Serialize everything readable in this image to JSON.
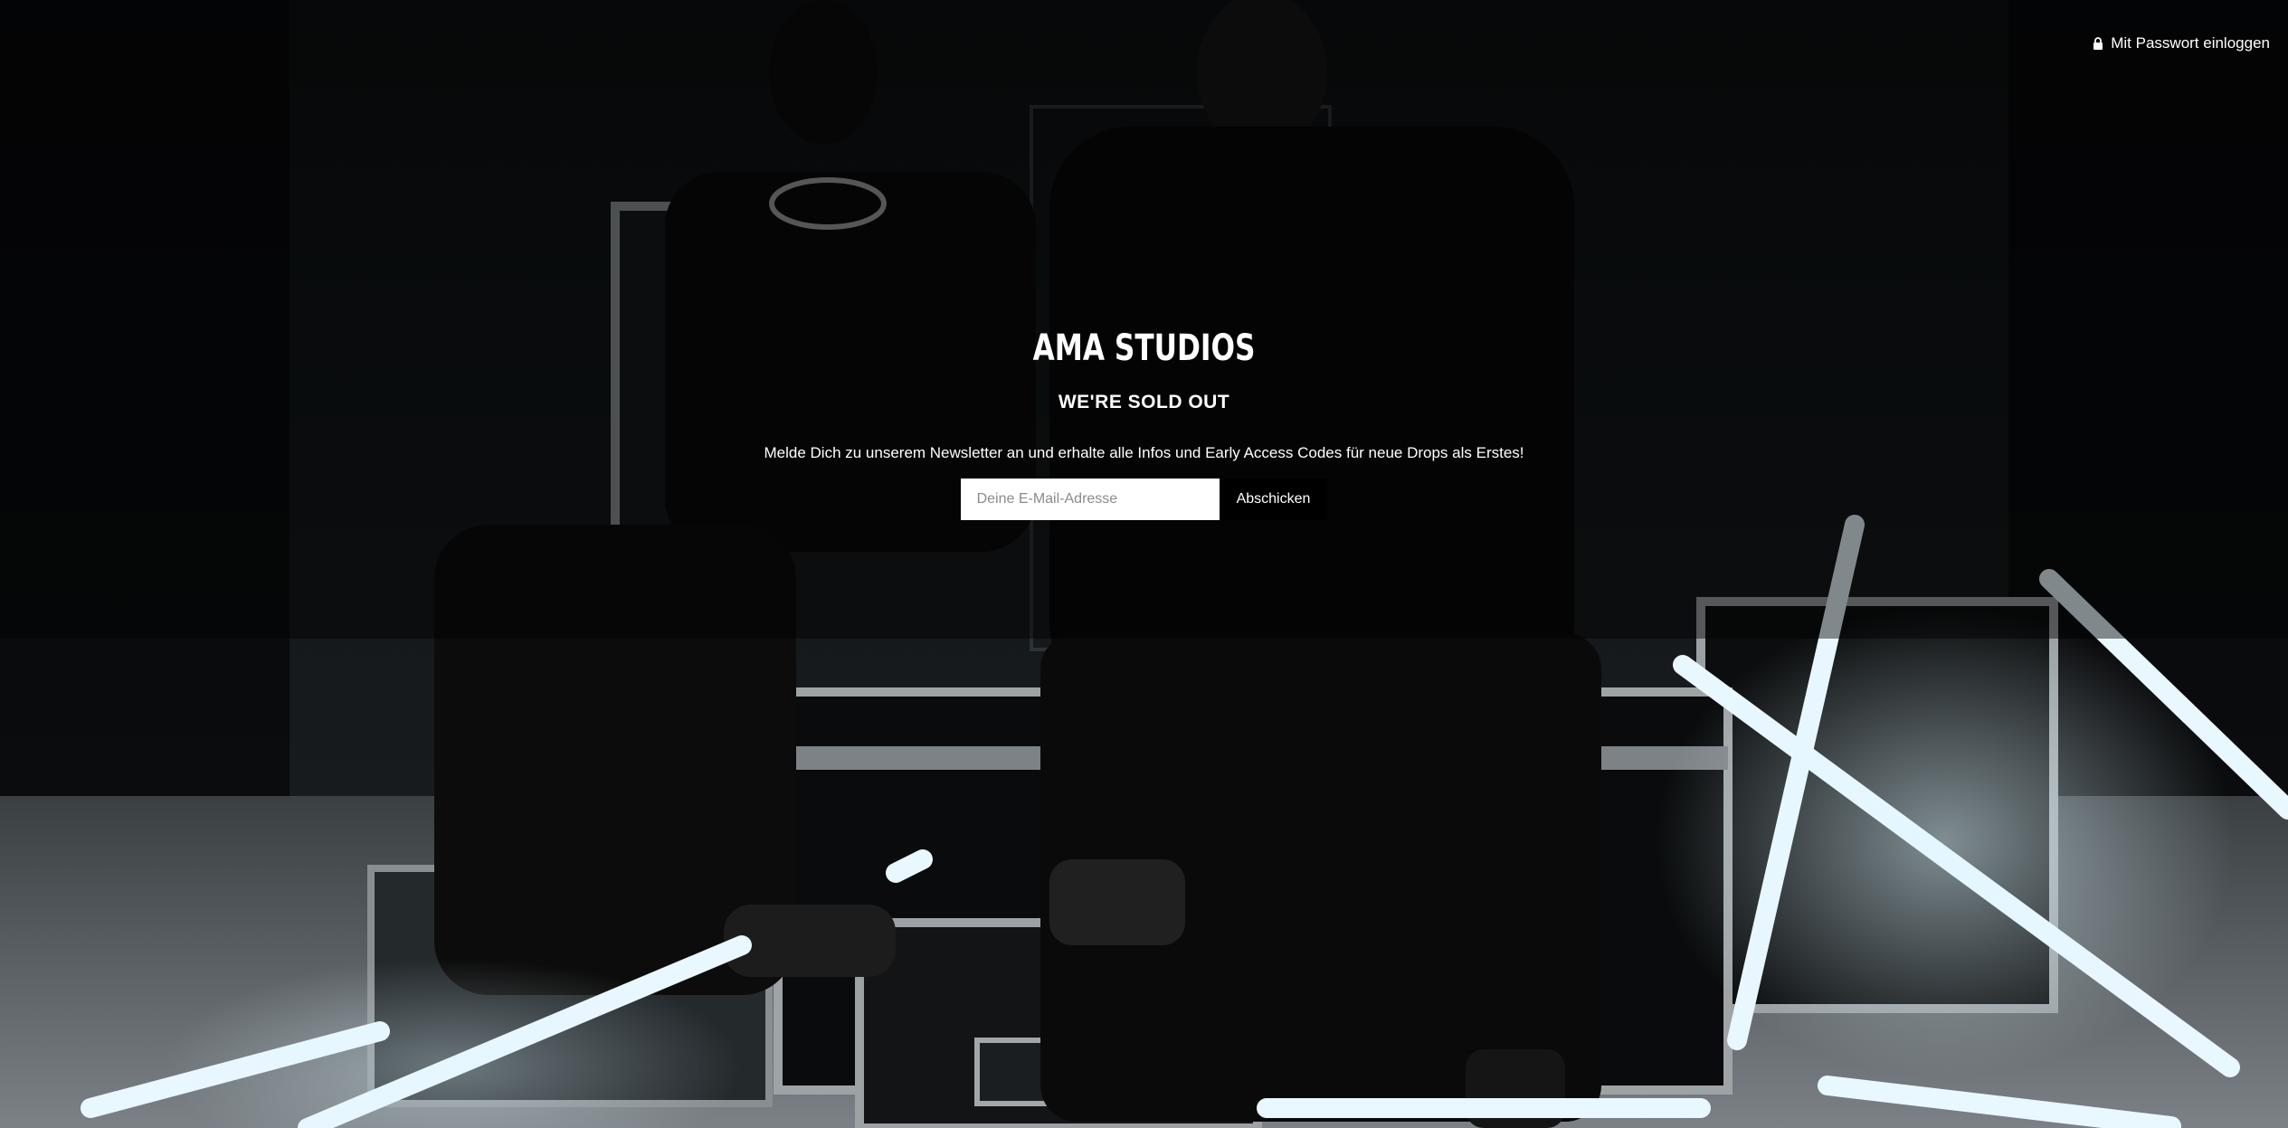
{
  "header": {
    "login_label": "Mit Passwort einloggen",
    "login_icon": "lock-icon"
  },
  "main": {
    "brand": "AMA STUDIOS",
    "headline": "WE'RE SOLD OUT",
    "newsletter_text": "Melde Dich zu unserem Newsletter an und erhalte alle Infos und Early Access Codes für neue Drops als Erstes!"
  },
  "form": {
    "email_placeholder": "Deine E-Mail-Adresse",
    "email_value": "",
    "submit_label": "Abschicken"
  },
  "colors": {
    "text": "#ffffff",
    "background": "#0b0c0d",
    "button": "#000000",
    "input": "#ffffff"
  }
}
